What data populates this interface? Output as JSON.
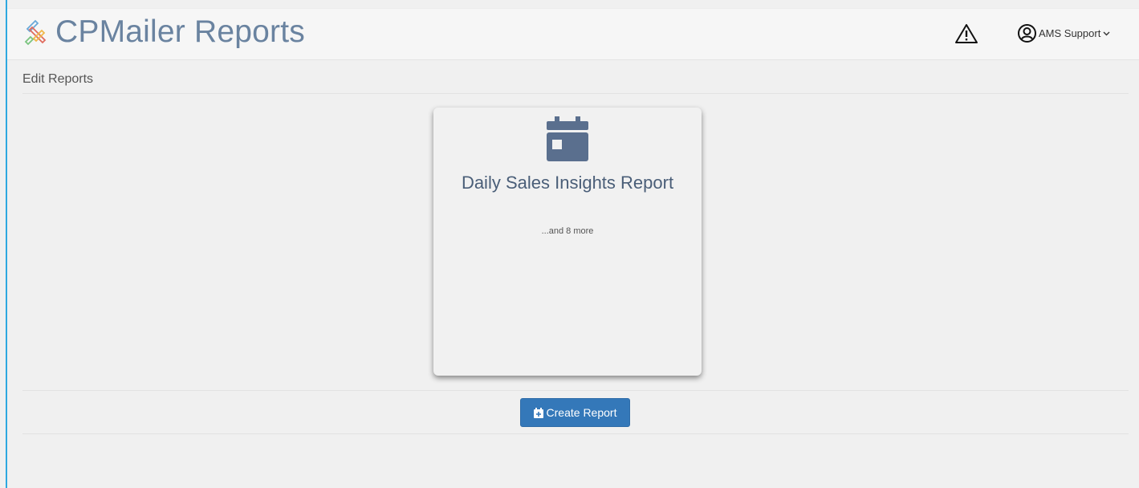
{
  "header": {
    "app_title": "CPMailer Reports",
    "logo_icon": "cpmailer-logo-icon",
    "alert_icon": "warning-triangle-icon",
    "user": {
      "name": "AMS Support",
      "avatar_icon": "user-circle-icon",
      "dropdown_icon": "chevron-down-icon"
    }
  },
  "main": {
    "section_title": "Edit Reports",
    "report_cards": [
      {
        "icon": "calendar-icon",
        "title": "Daily Sales Insights Report",
        "more_text": "...and 8 more"
      }
    ],
    "create_button": {
      "label": "Create Report",
      "icon": "calendar-plus-icon"
    }
  },
  "colors": {
    "accent": "#3478b9",
    "title_text": "#6a83a0",
    "card_icon": "#5a6f8e",
    "left_edge": "#2ea8e0"
  }
}
